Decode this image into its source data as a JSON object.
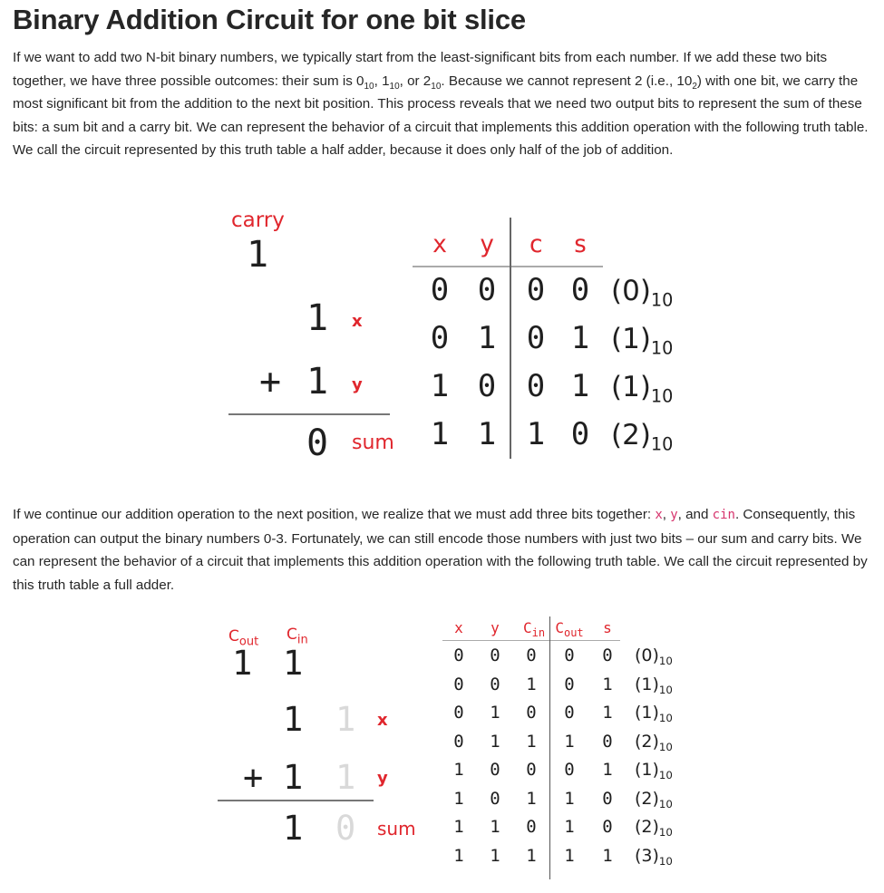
{
  "title": "Binary Addition Circuit for one bit slice",
  "paragraph1": {
    "a": "If we want to add two N-bit binary numbers, we typically start from the least-significant bits from each number. If we add these two bits together, we have three possible outcomes: their sum is 0",
    "s1": "10",
    "b": ", 1",
    "s2": "10",
    "c": ", or 2",
    "s3": "10",
    "d": ". Because we cannot represent 2 (i.e., 10",
    "s4": "2",
    "e": ") with one bit, we carry the most significant bit from the addition to the next bit position. This process reveals that we need two output bits to represent the sum of these bits: a sum bit and a carry bit. We can represent the behavior of a circuit that implements this addition operation with the following truth table. We call the circuit represented by this truth table a half adder, because it does only half of the job of addition."
  },
  "paragraph2": {
    "a": "If we continue our addition operation to the next position, we realize that we must add three bits together: ",
    "x": "x",
    "sep1": ", ",
    "y": "y",
    "sep2": ", and ",
    "cin": "cin",
    "b": ". Consequently, this operation can output the binary numbers 0-3. Fortunately, we can still encode those numbers with just two bits – our sum and carry bits. We can represent the behavior of a circuit that implements this addition operation with the following truth table. We call the circuit represented by this truth table a full adder."
  },
  "half_adder": {
    "carry_label": "carry",
    "carry_value": "1",
    "x_value": "1",
    "x_label": "x",
    "plus": "+",
    "y_value": "1",
    "y_label": "y",
    "sum_value": "0",
    "sum_label": "sum",
    "headers": [
      "x",
      "y",
      "c",
      "s"
    ],
    "rows": [
      {
        "x": "0",
        "y": "0",
        "c": "0",
        "s": "0",
        "dec": "(0)",
        "base": "10"
      },
      {
        "x": "0",
        "y": "1",
        "c": "0",
        "s": "1",
        "dec": "(1)",
        "base": "10"
      },
      {
        "x": "1",
        "y": "0",
        "c": "0",
        "s": "1",
        "dec": "(1)",
        "base": "10"
      },
      {
        "x": "1",
        "y": "1",
        "c": "1",
        "s": "0",
        "dec": "(2)",
        "base": "10"
      }
    ]
  },
  "full_adder": {
    "cout_label": "C",
    "cout_sub": "out",
    "cin_label": "C",
    "cin_sub": "in",
    "cout_value": "1",
    "cin_value": "1",
    "x_value": "1",
    "x_ghost": "1",
    "x_label": "x",
    "plus": "+",
    "y_value": "1",
    "y_ghost": "1",
    "y_label": "y",
    "sum_value": "1",
    "sum_ghost": "0",
    "sum_label": "sum",
    "headers": {
      "x": "x",
      "y": "y",
      "cin": "C",
      "cin_sub": "in",
      "cout": "C",
      "cout_sub": "out",
      "s": "s"
    },
    "rows": [
      {
        "x": "0",
        "y": "0",
        "cin": "0",
        "cout": "0",
        "s": "0",
        "dec": "(0)",
        "base": "10"
      },
      {
        "x": "0",
        "y": "0",
        "cin": "1",
        "cout": "0",
        "s": "1",
        "dec": "(1)",
        "base": "10"
      },
      {
        "x": "0",
        "y": "1",
        "cin": "0",
        "cout": "0",
        "s": "1",
        "dec": "(1)",
        "base": "10"
      },
      {
        "x": "0",
        "y": "1",
        "cin": "1",
        "cout": "1",
        "s": "0",
        "dec": "(2)",
        "base": "10"
      },
      {
        "x": "1",
        "y": "0",
        "cin": "0",
        "cout": "0",
        "s": "1",
        "dec": "(1)",
        "base": "10"
      },
      {
        "x": "1",
        "y": "0",
        "cin": "1",
        "cout": "1",
        "s": "0",
        "dec": "(2)",
        "base": "10"
      },
      {
        "x": "1",
        "y": "1",
        "cin": "0",
        "cout": "1",
        "s": "0",
        "dec": "(2)",
        "base": "10"
      },
      {
        "x": "1",
        "y": "1",
        "cin": "1",
        "cout": "1",
        "s": "1",
        "dec": "(3)",
        "base": "10"
      }
    ]
  }
}
